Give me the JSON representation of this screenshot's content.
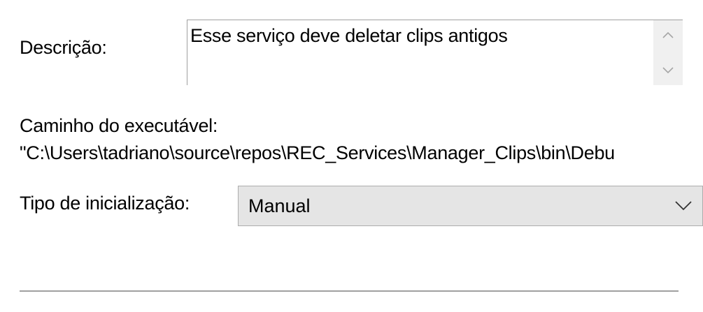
{
  "description": {
    "label": "Descrição:",
    "value": "Esse serviço deve deletar clips antigos"
  },
  "executable_path": {
    "label": "Caminho do executável:",
    "value": "\"C:\\Users\\tadriano\\source\\repos\\REC_Services\\Manager_Clips\\bin\\Debu"
  },
  "startup_type": {
    "label": "Tipo de inicialização:",
    "selected": "Manual"
  },
  "icons": {
    "scroll_up": "chevron-up-icon",
    "scroll_down": "chevron-down-icon",
    "dropdown": "chevron-down-icon"
  },
  "colors": {
    "select_background": "#e5e5e5",
    "scrollbar_background": "#f0f0f0",
    "border": "#a0a0a0"
  }
}
